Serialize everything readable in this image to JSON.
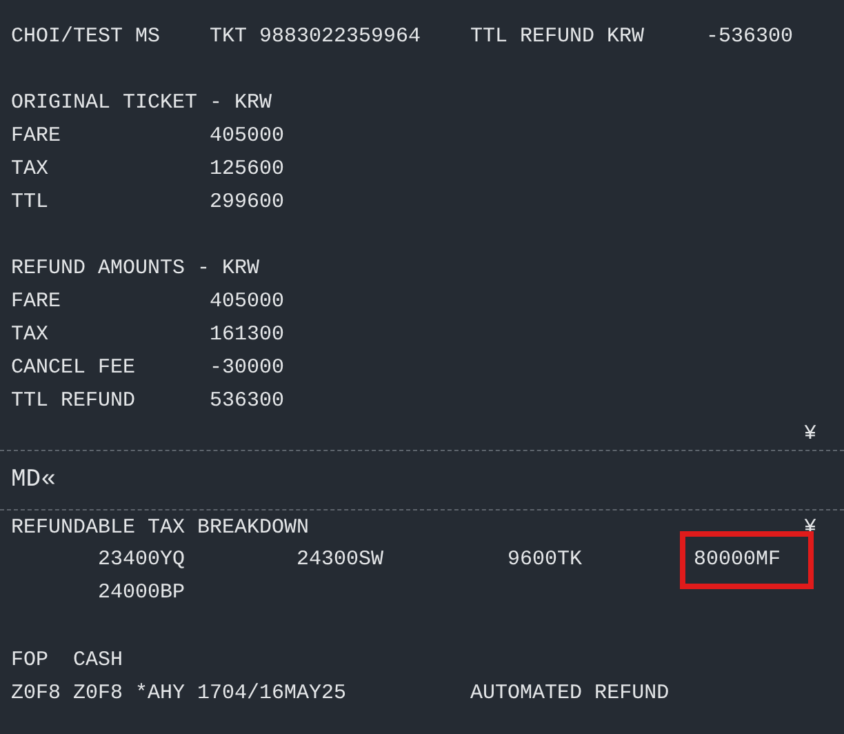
{
  "header": {
    "name": "CHOI/TEST MS",
    "ticket": "TKT 9883022359964",
    "total_label": "TTL REFUND KRW",
    "total_value": "-536300"
  },
  "sections": [
    {
      "title": "ORIGINAL TICKET - KRW",
      "rows": [
        {
          "label": "FARE",
          "value": "405000"
        },
        {
          "label": "TAX",
          "value": "125600"
        },
        {
          "label": "TTL",
          "value": "299600"
        }
      ]
    },
    {
      "title": "REFUND AMOUNTS - KRW",
      "rows": [
        {
          "label": "FARE",
          "value": "405000"
        },
        {
          "label": "TAX",
          "value": "161300"
        },
        {
          "label": "CANCEL FEE",
          "value": "-30000"
        },
        {
          "label": "TTL REFUND",
          "value": "536300"
        }
      ]
    }
  ],
  "end_mark": "¥",
  "command": "MD«",
  "tax_breakdown": {
    "title": "REFUNDABLE TAX BREAKDOWN",
    "mark": "¥",
    "items": [
      {
        "text": "23400YQ",
        "highlighted": false
      },
      {
        "text": "24300SW",
        "highlighted": false
      },
      {
        "text": "9600TK",
        "highlighted": false
      },
      {
        "text": "80000MF",
        "highlighted": true
      },
      {
        "text": "24000BP",
        "highlighted": false
      }
    ]
  },
  "fop": {
    "label": "FOP",
    "value": "CASH"
  },
  "footer": {
    "agent": "Z0F8 Z0F8 *AHY 1704/16MAY25",
    "note": "AUTOMATED REFUND"
  }
}
